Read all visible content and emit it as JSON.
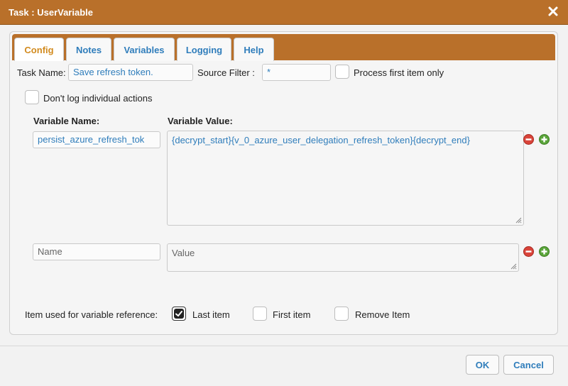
{
  "window": {
    "title": "Task : UserVariable"
  },
  "tabs": [
    {
      "label": "Config",
      "active": true
    },
    {
      "label": "Notes"
    },
    {
      "label": "Variables"
    },
    {
      "label": "Logging"
    },
    {
      "label": "Help"
    }
  ],
  "config": {
    "task_name_label": "Task Name:",
    "task_name_value": "Save refresh token.",
    "source_filter_label": "Source Filter :",
    "source_filter_value": "*",
    "process_first_label": "Process first item only",
    "process_first_checked": false,
    "dont_log_label": "Don't log individual actions",
    "dont_log_checked": false
  },
  "variables": {
    "name_header": "Variable Name:",
    "value_header": "Variable Value:",
    "rows": [
      {
        "name": "persist_azure_refresh_tok",
        "value": "{decrypt_start}{v_0_azure_user_delegation_refresh_token}{decrypt_end}"
      }
    ],
    "new_row": {
      "name_placeholder": "Name",
      "value_placeholder": "Value"
    }
  },
  "reference": {
    "label": "Item used for variable reference:",
    "options": [
      {
        "label": "Last item",
        "checked": true
      },
      {
        "label": "First item",
        "checked": false
      },
      {
        "label": "Remove Item",
        "checked": false
      }
    ]
  },
  "buttons": {
    "ok": "OK",
    "cancel": "Cancel"
  },
  "colors": {
    "accent": "#b9702a",
    "link": "#2f7dbb",
    "active_tab": "#d28b1f"
  },
  "icons": {
    "close": "close-icon",
    "remove": "remove-circle-icon",
    "add": "add-circle-icon"
  }
}
